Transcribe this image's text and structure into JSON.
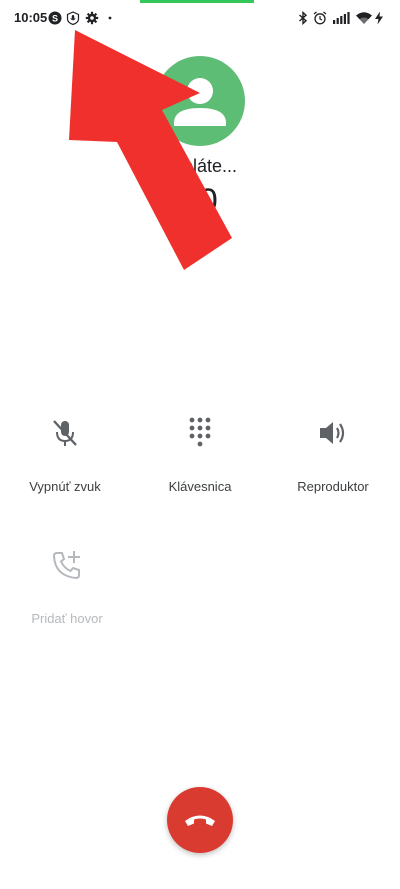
{
  "status_bar": {
    "time": "10:05",
    "left_icons": [
      "skype-icon",
      "shield-mic-icon",
      "gear-icon",
      "dot-icon"
    ],
    "right_icons": [
      "bluetooth-icon",
      "alarm-icon",
      "signal-icon",
      "wifi-icon",
      "charging-icon"
    ]
  },
  "call": {
    "status": "Vytáčanie cez: Bezplatné...",
    "status_visible": "ypláte...",
    "number": "0",
    "number_visible": "50"
  },
  "controls": {
    "mute_label": "Vypnúť zvuk",
    "keypad_label": "Klávesnica",
    "speaker_label": "Reproduktor",
    "add_call_label": "Pridať hovor"
  },
  "colors": {
    "accent_green": "#34c759",
    "avatar_green": "#5ebd74",
    "end_call_red": "#d93b30",
    "annotation_red": "#f0302c"
  }
}
